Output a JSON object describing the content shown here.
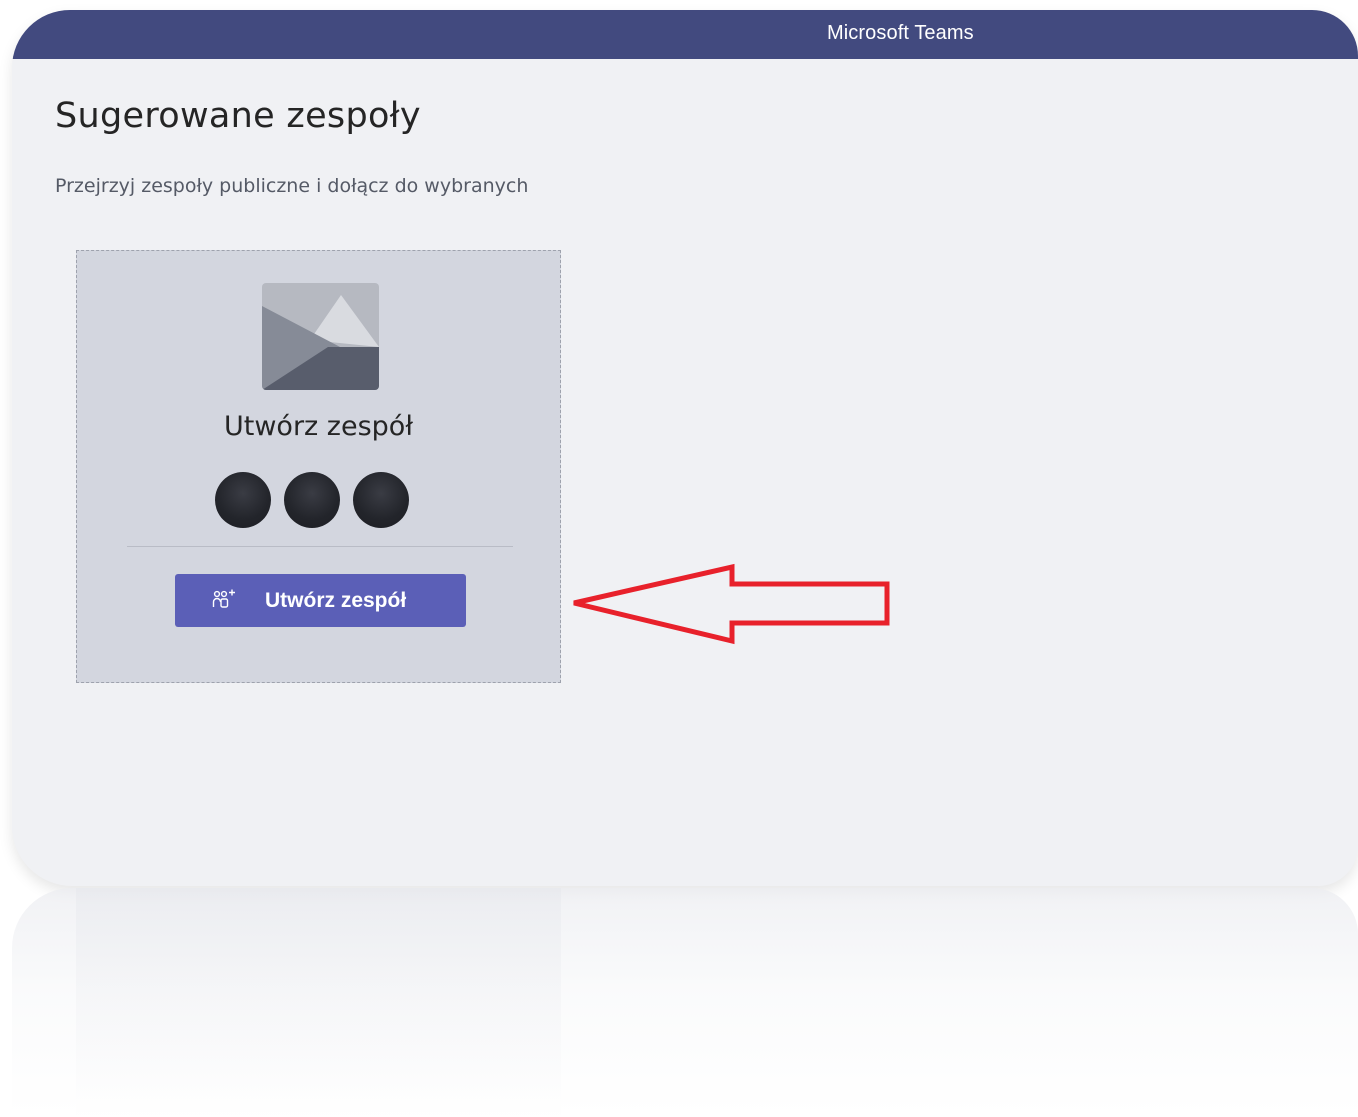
{
  "window": {
    "title": "Microsoft Teams"
  },
  "page": {
    "title": "Sugerowane zespoły",
    "subtitle": "Przejrzyj zespoły publiczne i dołącz do wybranych"
  },
  "create_card": {
    "title": "Utwórz zespół",
    "image_icon": "team-placeholder-image-icon",
    "avatar_count": 3,
    "button": {
      "label": "Utwórz zespół",
      "icon": "add-team-icon"
    }
  },
  "annotation": {
    "arrow_color": "#e8212b",
    "direction": "left"
  },
  "colors": {
    "titlebar": "#424a7f",
    "accent": "#5b5fb7",
    "card_background": "#d3d6df",
    "page_background": "#f0f1f4"
  }
}
